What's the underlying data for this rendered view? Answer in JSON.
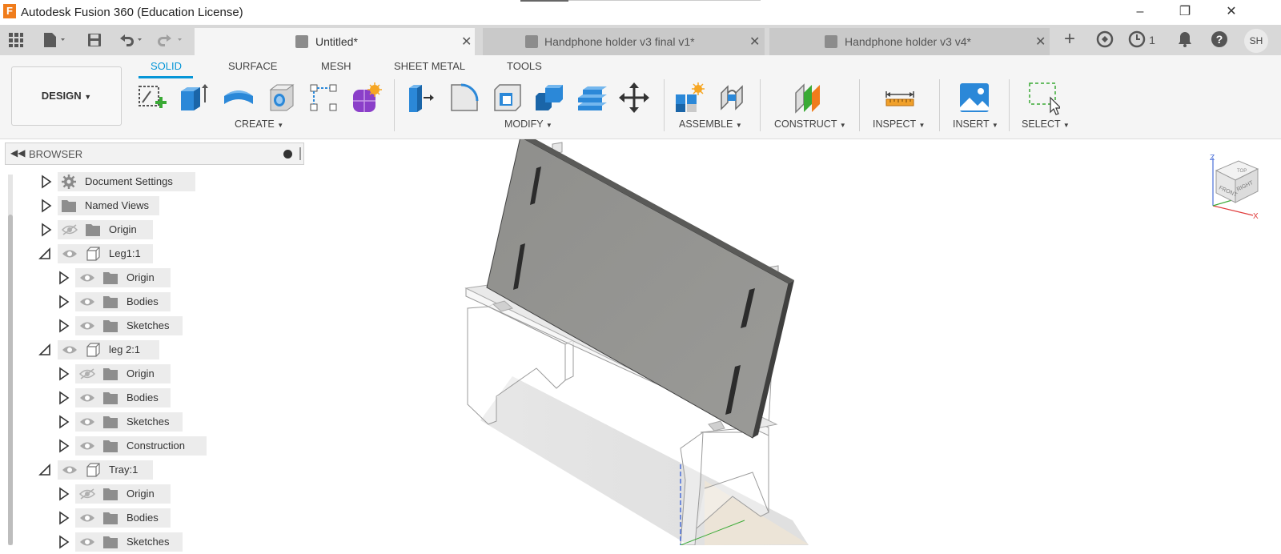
{
  "window": {
    "title": "Autodesk Fusion 360 (Education License)",
    "logo_letter": "F",
    "minimize": "–",
    "restore": "❐",
    "close": "✕"
  },
  "tabs": [
    {
      "label": "Untitled*",
      "active": true
    },
    {
      "label": "Handphone holder v3 final v1*",
      "active": false
    },
    {
      "label": "Handphone holder v3 v4*",
      "active": false
    }
  ],
  "tab_close": "✕",
  "topbar": {
    "add_tab": "+",
    "jobs_count": "1",
    "user_initials": "SH",
    "help": "?"
  },
  "workspace_tabs": [
    "SOLID",
    "SURFACE",
    "MESH",
    "SHEET METAL",
    "TOOLS"
  ],
  "design_button": "DESIGN",
  "toolbar_groups": {
    "create": "CREATE",
    "modify": "MODIFY",
    "assemble": "ASSEMBLE",
    "construct": "CONSTRUCT",
    "inspect": "INSPECT",
    "insert": "INSERT",
    "select": "SELECT"
  },
  "browser": {
    "title": "BROWSER",
    "nodes": [
      {
        "label": "Document Settings",
        "expanded": false,
        "icon": "gear-icon",
        "eye": "none"
      },
      {
        "label": "Named Views",
        "expanded": false,
        "icon": "folder-icon",
        "eye": "none"
      },
      {
        "label": "Origin",
        "expanded": false,
        "icon": "folder-icon",
        "eye": "hidden"
      },
      {
        "label": "Leg1:1",
        "expanded": true,
        "icon": "component-icon",
        "eye": "visible"
      },
      {
        "label": "Origin",
        "expanded": false,
        "icon": "folder-icon",
        "eye": "visible"
      },
      {
        "label": "Bodies",
        "expanded": false,
        "icon": "folder-icon",
        "eye": "visible"
      },
      {
        "label": "Sketches",
        "expanded": false,
        "icon": "folder-icon",
        "eye": "visible"
      },
      {
        "label": "leg 2:1",
        "expanded": true,
        "icon": "component-icon",
        "eye": "visible"
      },
      {
        "label": "Origin",
        "expanded": false,
        "icon": "folder-icon",
        "eye": "hidden"
      },
      {
        "label": "Bodies",
        "expanded": false,
        "icon": "folder-icon",
        "eye": "visible"
      },
      {
        "label": "Sketches",
        "expanded": false,
        "icon": "folder-icon",
        "eye": "visible"
      },
      {
        "label": "Construction",
        "expanded": false,
        "icon": "folder-icon",
        "eye": "visible"
      },
      {
        "label": "Tray:1",
        "expanded": true,
        "icon": "component-icon",
        "eye": "visible"
      },
      {
        "label": "Origin",
        "expanded": false,
        "icon": "folder-icon",
        "eye": "hidden"
      },
      {
        "label": "Bodies",
        "expanded": false,
        "icon": "folder-icon",
        "eye": "visible"
      },
      {
        "label": "Sketches",
        "expanded": false,
        "icon": "folder-icon",
        "eye": "visible"
      }
    ]
  },
  "viewcube": {
    "top": "TOP",
    "front": "FRONT",
    "right": "RIGHT",
    "z": "Z",
    "x": "X"
  },
  "colors": {
    "accent": "#0696d7",
    "brand": "#f07c1b"
  }
}
